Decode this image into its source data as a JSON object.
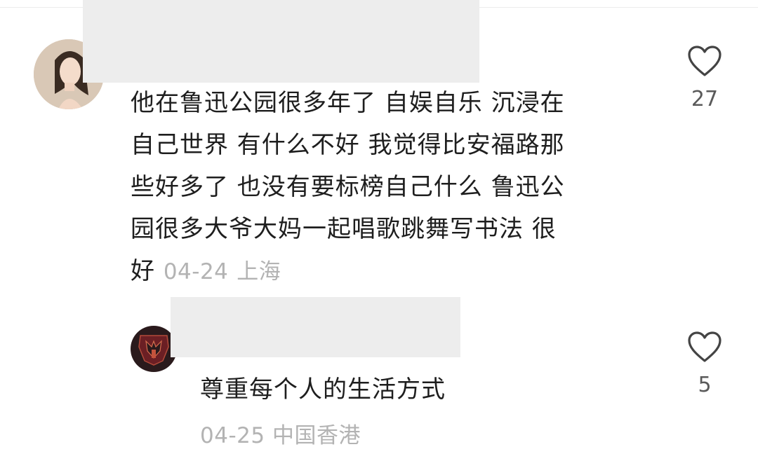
{
  "comment": {
    "lines": [
      "他在鲁迅公园很多年了 自娱自乐 沉浸在",
      "自己世界 有什么不好 我觉得比安福路那",
      "些好多了 也没有要标榜自己什么 鲁迅公",
      "园很多大爷大妈一起唱歌跳舞写书法 很",
      "好"
    ],
    "date": "04-24",
    "location": "上海",
    "like_count": "27",
    "like_icon": "heart-outline-icon"
  },
  "reply": {
    "text": "尊重每个人的生活方式",
    "date": "04-25",
    "location": "中国香港",
    "like_count": "5",
    "like_icon": "heart-outline-icon"
  },
  "colors": {
    "text": "#1e1e1e",
    "meta": "#b3b3b3",
    "redaction": "#ededed"
  }
}
